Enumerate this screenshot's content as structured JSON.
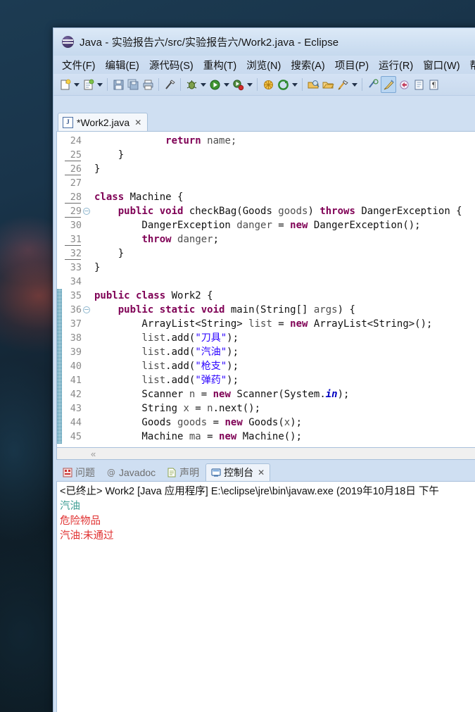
{
  "window": {
    "title": "Java - 实验报告六/src/实验报告六/Work2.java - Eclipse",
    "logo_icon": "java-logo-icon"
  },
  "menubar": {
    "items": [
      {
        "label": "文件(F)"
      },
      {
        "label": "编辑(E)"
      },
      {
        "label": "源代码(S)"
      },
      {
        "label": "重构(T)"
      },
      {
        "label": "浏览(N)"
      },
      {
        "label": "搜索(A)"
      },
      {
        "label": "项目(P)"
      },
      {
        "label": "运行(R)"
      },
      {
        "label": "窗口(W)"
      },
      {
        "label": "帮"
      }
    ]
  },
  "toolbar": {
    "buttons": [
      {
        "name": "new-wizard-icon"
      },
      {
        "name": "new-wizard-dropdown-icon"
      },
      {
        "name": "new-java-class-icon"
      },
      {
        "name": "new-java-class-dropdown-icon"
      },
      {
        "name": "save-icon"
      },
      {
        "name": "save-all-icon"
      },
      {
        "name": "print-icon"
      },
      {
        "name": "toggle-mark-occurrences-icon"
      },
      {
        "name": "debug-icon"
      },
      {
        "name": "debug-dropdown-icon"
      },
      {
        "name": "run-icon"
      },
      {
        "name": "run-dropdown-icon"
      },
      {
        "name": "run-external-tools-icon"
      },
      {
        "name": "run-external-tools-dropdown-icon"
      },
      {
        "name": "new-java-package-icon"
      },
      {
        "name": "external-tools-icon"
      },
      {
        "name": "external-tools-dropdown-icon"
      },
      {
        "name": "open-type-icon"
      },
      {
        "name": "open-task-icon"
      },
      {
        "name": "search-icon"
      },
      {
        "name": "search-dropdown-icon"
      },
      {
        "name": "next-annotation-icon"
      },
      {
        "name": "previous-edit-icon"
      },
      {
        "name": "back-icon"
      },
      {
        "name": "forward-icon"
      }
    ]
  },
  "editor": {
    "tab": {
      "file_icon": "java-file-icon",
      "icon_letter": "J",
      "label": "*Work2.java",
      "close_label": "✕"
    },
    "first_line_number": 24,
    "lines": [
      {
        "n": 24,
        "marked": false,
        "fold": false,
        "changed": false,
        "tokens": [
          {
            "t": "            ",
            "c": "pln"
          },
          {
            "t": "return",
            "c": "kw"
          },
          {
            "t": " ",
            "c": "pln"
          },
          {
            "t": "name",
            "c": "pln"
          },
          {
            "t": ";",
            "c": "pln"
          }
        ]
      },
      {
        "n": 25,
        "marked": true,
        "fold": false,
        "changed": false,
        "tokens": [
          {
            "t": "    ",
            "c": "pln"
          },
          {
            "t": "}",
            "c": "blk"
          }
        ]
      },
      {
        "n": 26,
        "marked": true,
        "fold": false,
        "changed": false,
        "tokens": [
          {
            "t": "}",
            "c": "blk"
          }
        ]
      },
      {
        "n": 27,
        "marked": false,
        "fold": false,
        "changed": false,
        "tokens": []
      },
      {
        "n": 28,
        "marked": true,
        "fold": false,
        "changed": false,
        "tokens": [
          {
            "t": "class",
            "c": "kw"
          },
          {
            "t": " Machine {",
            "c": "blk"
          }
        ]
      },
      {
        "n": 29,
        "marked": true,
        "fold": true,
        "changed": false,
        "tokens": [
          {
            "t": "    ",
            "c": "pln"
          },
          {
            "t": "public void",
            "c": "kw"
          },
          {
            "t": " checkBag(Goods ",
            "c": "blk"
          },
          {
            "t": "goods",
            "c": "pln"
          },
          {
            "t": ") ",
            "c": "blk"
          },
          {
            "t": "throws",
            "c": "kw"
          },
          {
            "t": " DangerException {",
            "c": "blk"
          }
        ]
      },
      {
        "n": 30,
        "marked": false,
        "fold": false,
        "changed": false,
        "tokens": [
          {
            "t": "        DangerException ",
            "c": "blk"
          },
          {
            "t": "danger",
            "c": "pln"
          },
          {
            "t": " = ",
            "c": "blk"
          },
          {
            "t": "new",
            "c": "kw"
          },
          {
            "t": " DangerException();",
            "c": "blk"
          }
        ]
      },
      {
        "n": 31,
        "marked": true,
        "fold": false,
        "changed": false,
        "tokens": [
          {
            "t": "        ",
            "c": "pln"
          },
          {
            "t": "throw",
            "c": "kw"
          },
          {
            "t": " ",
            "c": "pln"
          },
          {
            "t": "danger",
            "c": "pln"
          },
          {
            "t": ";",
            "c": "blk"
          }
        ]
      },
      {
        "n": 32,
        "marked": true,
        "fold": false,
        "changed": false,
        "tokens": [
          {
            "t": "    ",
            "c": "pln"
          },
          {
            "t": "}",
            "c": "blk"
          }
        ]
      },
      {
        "n": 33,
        "marked": false,
        "fold": false,
        "changed": false,
        "tokens": [
          {
            "t": "}",
            "c": "blk"
          }
        ]
      },
      {
        "n": 34,
        "marked": false,
        "fold": false,
        "changed": false,
        "tokens": []
      },
      {
        "n": 35,
        "marked": false,
        "fold": false,
        "changed": true,
        "tokens": [
          {
            "t": "public class",
            "c": "kw"
          },
          {
            "t": " Work2 {",
            "c": "blk"
          }
        ]
      },
      {
        "n": 36,
        "marked": false,
        "fold": true,
        "changed": true,
        "tokens": [
          {
            "t": "    ",
            "c": "pln"
          },
          {
            "t": "public static void",
            "c": "kw"
          },
          {
            "t": " main(String[] ",
            "c": "blk"
          },
          {
            "t": "args",
            "c": "pln"
          },
          {
            "t": ") {",
            "c": "blk"
          }
        ]
      },
      {
        "n": 37,
        "marked": false,
        "fold": false,
        "changed": true,
        "tokens": [
          {
            "t": "        ArrayList<String> ",
            "c": "blk"
          },
          {
            "t": "list",
            "c": "pln"
          },
          {
            "t": " = ",
            "c": "blk"
          },
          {
            "t": "new",
            "c": "kw"
          },
          {
            "t": " ArrayList<String>();",
            "c": "blk"
          }
        ]
      },
      {
        "n": 38,
        "marked": false,
        "fold": false,
        "changed": true,
        "tokens": [
          {
            "t": "        ",
            "c": "pln"
          },
          {
            "t": "list",
            "c": "pln"
          },
          {
            "t": ".add(",
            "c": "blk"
          },
          {
            "t": "\"刀具\"",
            "c": "str"
          },
          {
            "t": ");",
            "c": "blk"
          }
        ]
      },
      {
        "n": 39,
        "marked": false,
        "fold": false,
        "changed": true,
        "tokens": [
          {
            "t": "        ",
            "c": "pln"
          },
          {
            "t": "list",
            "c": "pln"
          },
          {
            "t": ".add(",
            "c": "blk"
          },
          {
            "t": "\"汽油\"",
            "c": "str"
          },
          {
            "t": ");",
            "c": "blk"
          }
        ]
      },
      {
        "n": 40,
        "marked": false,
        "fold": false,
        "changed": true,
        "tokens": [
          {
            "t": "        ",
            "c": "pln"
          },
          {
            "t": "list",
            "c": "pln"
          },
          {
            "t": ".add(",
            "c": "blk"
          },
          {
            "t": "\"枪支\"",
            "c": "str"
          },
          {
            "t": ");",
            "c": "blk"
          }
        ]
      },
      {
        "n": 41,
        "marked": false,
        "fold": false,
        "changed": true,
        "tokens": [
          {
            "t": "        ",
            "c": "pln"
          },
          {
            "t": "list",
            "c": "pln"
          },
          {
            "t": ".add(",
            "c": "blk"
          },
          {
            "t": "\"弹药\"",
            "c": "str"
          },
          {
            "t": ");",
            "c": "blk"
          }
        ]
      },
      {
        "n": 42,
        "marked": false,
        "fold": false,
        "changed": true,
        "tokens": [
          {
            "t": "        Scanner ",
            "c": "blk"
          },
          {
            "t": "n",
            "c": "pln"
          },
          {
            "t": " = ",
            "c": "blk"
          },
          {
            "t": "new",
            "c": "kw"
          },
          {
            "t": " Scanner(System.",
            "c": "blk"
          },
          {
            "t": "in",
            "c": "fld"
          },
          {
            "t": ");",
            "c": "blk"
          }
        ]
      },
      {
        "n": 43,
        "marked": false,
        "fold": false,
        "changed": true,
        "tokens": [
          {
            "t": "        String ",
            "c": "blk"
          },
          {
            "t": "x",
            "c": "pln"
          },
          {
            "t": " = ",
            "c": "blk"
          },
          {
            "t": "n",
            "c": "pln"
          },
          {
            "t": ".next();",
            "c": "blk"
          }
        ]
      },
      {
        "n": 44,
        "marked": false,
        "fold": false,
        "changed": true,
        "tokens": [
          {
            "t": "        Goods ",
            "c": "blk"
          },
          {
            "t": "goods",
            "c": "pln"
          },
          {
            "t": " = ",
            "c": "blk"
          },
          {
            "t": "new",
            "c": "kw"
          },
          {
            "t": " Goods(",
            "c": "blk"
          },
          {
            "t": "x",
            "c": "pln"
          },
          {
            "t": ");",
            "c": "blk"
          }
        ]
      },
      {
        "n": 45,
        "marked": false,
        "fold": false,
        "changed": true,
        "tokens": [
          {
            "t": "        Machine ",
            "c": "blk"
          },
          {
            "t": "ma",
            "c": "pln"
          },
          {
            "t": " = ",
            "c": "blk"
          },
          {
            "t": "new",
            "c": "kw"
          },
          {
            "t": " Machine();",
            "c": "blk"
          }
        ]
      }
    ],
    "hscroll_glyph": "«"
  },
  "console_panel": {
    "tabs": [
      {
        "label": "问题",
        "icon": "problems-icon",
        "active": false
      },
      {
        "label": "Javadoc",
        "icon": "javadoc-at-icon",
        "active": false
      },
      {
        "label": "声明",
        "icon": "declaration-icon",
        "active": false
      },
      {
        "label": "控制台",
        "icon": "console-icon",
        "active": true
      }
    ],
    "close_label": "✕",
    "output": [
      {
        "text": "<已终止> Work2 [Java 应用程序] E:\\eclipse\\jre\\bin\\javaw.exe  (2019年10月18日 下午",
        "kind": "header"
      },
      {
        "text": "汽油",
        "kind": "out"
      },
      {
        "text": "危险物品",
        "kind": "err"
      },
      {
        "text": "汽油:未通过",
        "kind": "err"
      }
    ]
  },
  "colors": {
    "desktop": "#16303f",
    "chrome": "#cfdff2",
    "keyword": "#7f0055",
    "string": "#2a00ff",
    "field": "#0000c0",
    "console_out": "#3f9e94",
    "console_err": "#e03030"
  }
}
